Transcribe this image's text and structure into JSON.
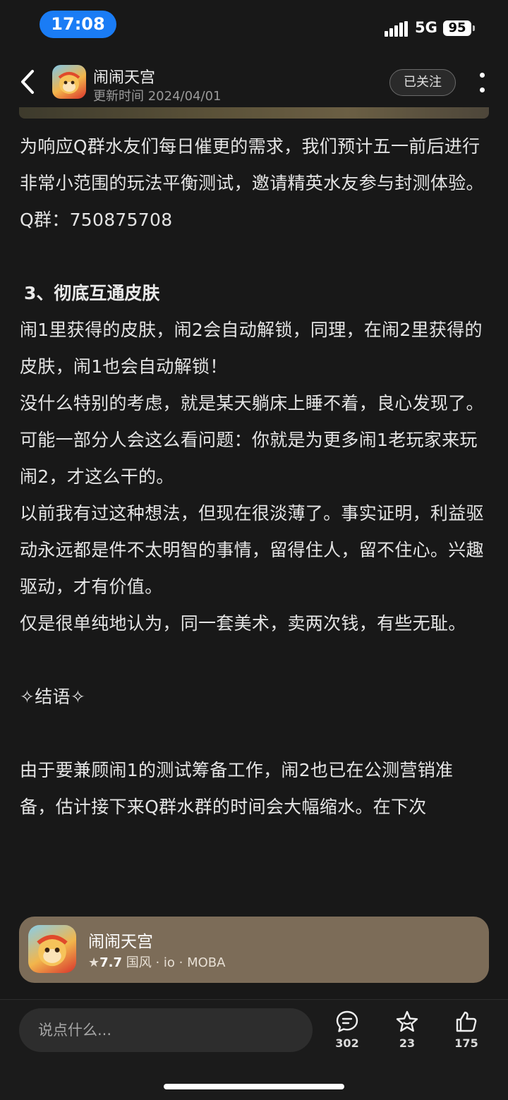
{
  "status_bar": {
    "time": "17:08",
    "network": "5G",
    "battery": "95"
  },
  "header": {
    "title": "闹闹天宫",
    "updated": "更新时间 2024/04/01",
    "follow_label": "已关注"
  },
  "article": {
    "p1": "为响应Q群水友们每日催更的需求，我们预计五一前后进行非常小范围的玩法平衡测试，邀请精英水友参与封测体验。",
    "p2": "Q群：750875708",
    "heading3": "3、彻底互通皮肤",
    "p3": "闹1里获得的皮肤，闹2会自动解锁，同理，在闹2里获得的皮肤，闹1也会自动解锁！",
    "p4": "没什么特别的考虑，就是某天躺床上睡不着，良心发现了。",
    "p5": "可能一部分人会这么看问题：你就是为更多闹1老玩家来玩闹2，才这么干的。",
    "p6": "以前我有过这种想法，但现在很淡薄了。事实证明，利益驱动永远都是件不太明智的事情，留得住人，留不住心。兴趣驱动，才有价值。",
    "p7": "仅是很单纯地认为，同一套美术，卖两次钱，有些无耻。",
    "epilogue": "✧结语✧",
    "p8": "由于要兼顾闹1的测试筹备工作，闹2也已在公测营销准备，估计接下来Q群水群的时间会大幅缩水。在下次"
  },
  "app_card": {
    "name": "闹闹天宫",
    "rating": "7.7",
    "tags": "国风 · io · MOBA"
  },
  "bottom_bar": {
    "comment_placeholder": "说点什么...",
    "comments_count": "302",
    "favorites_count": "23",
    "likes_count": "175"
  }
}
